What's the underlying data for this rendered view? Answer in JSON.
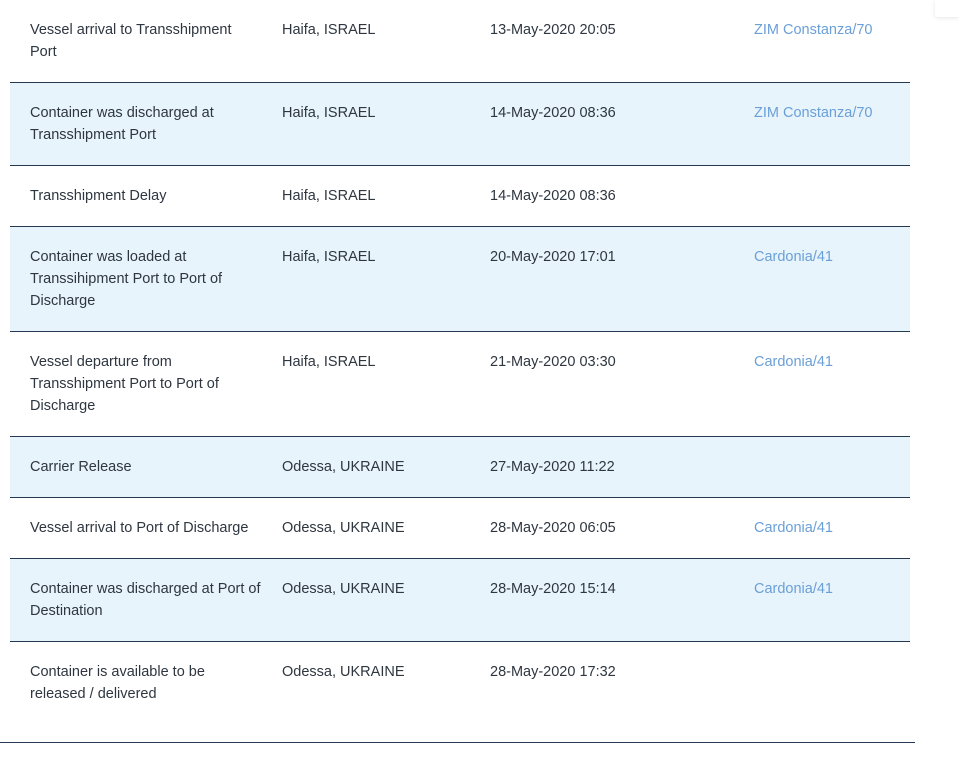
{
  "events": [
    {
      "event": "Vessel arrival to Transshipment Port",
      "location": "Haifa, ISRAEL",
      "date": "13-May-2020 20:05",
      "vessel": "ZIM Constanza/70"
    },
    {
      "event": "Container was discharged at Transshipment Port",
      "location": "Haifa, ISRAEL",
      "date": "14-May-2020 08:36",
      "vessel": "ZIM Constanza/70"
    },
    {
      "event": "Transshipment Delay",
      "location": "Haifa, ISRAEL",
      "date": "14-May-2020 08:36",
      "vessel": ""
    },
    {
      "event": "Container was loaded at Transsihipment Port to Port of Discharge",
      "location": "Haifa, ISRAEL",
      "date": "20-May-2020 17:01",
      "vessel": "Cardonia/41"
    },
    {
      "event": "Vessel departure from Transshipment Port to Port of Discharge",
      "location": "Haifa, ISRAEL",
      "date": "21-May-2020 03:30",
      "vessel": "Cardonia/41"
    },
    {
      "event": "Carrier Release",
      "location": "Odessa, UKRAINE",
      "date": "27-May-2020 11:22",
      "vessel": ""
    },
    {
      "event": "Vessel arrival to Port of Discharge",
      "location": "Odessa, UKRAINE",
      "date": "28-May-2020 06:05",
      "vessel": "Cardonia/41"
    },
    {
      "event": "Container was discharged at Port of Destination",
      "location": "Odessa, UKRAINE",
      "date": "28-May-2020 15:14",
      "vessel": "Cardonia/41"
    },
    {
      "event": "Container is available to be released / delivered",
      "location": "Odessa, UKRAINE",
      "date": "28-May-2020 17:32",
      "vessel": ""
    }
  ],
  "colors": {
    "alt_row_bg": "#e8f4fb",
    "divider": "#273a52",
    "link": "#6a9fd8",
    "text": "#2e3640"
  }
}
